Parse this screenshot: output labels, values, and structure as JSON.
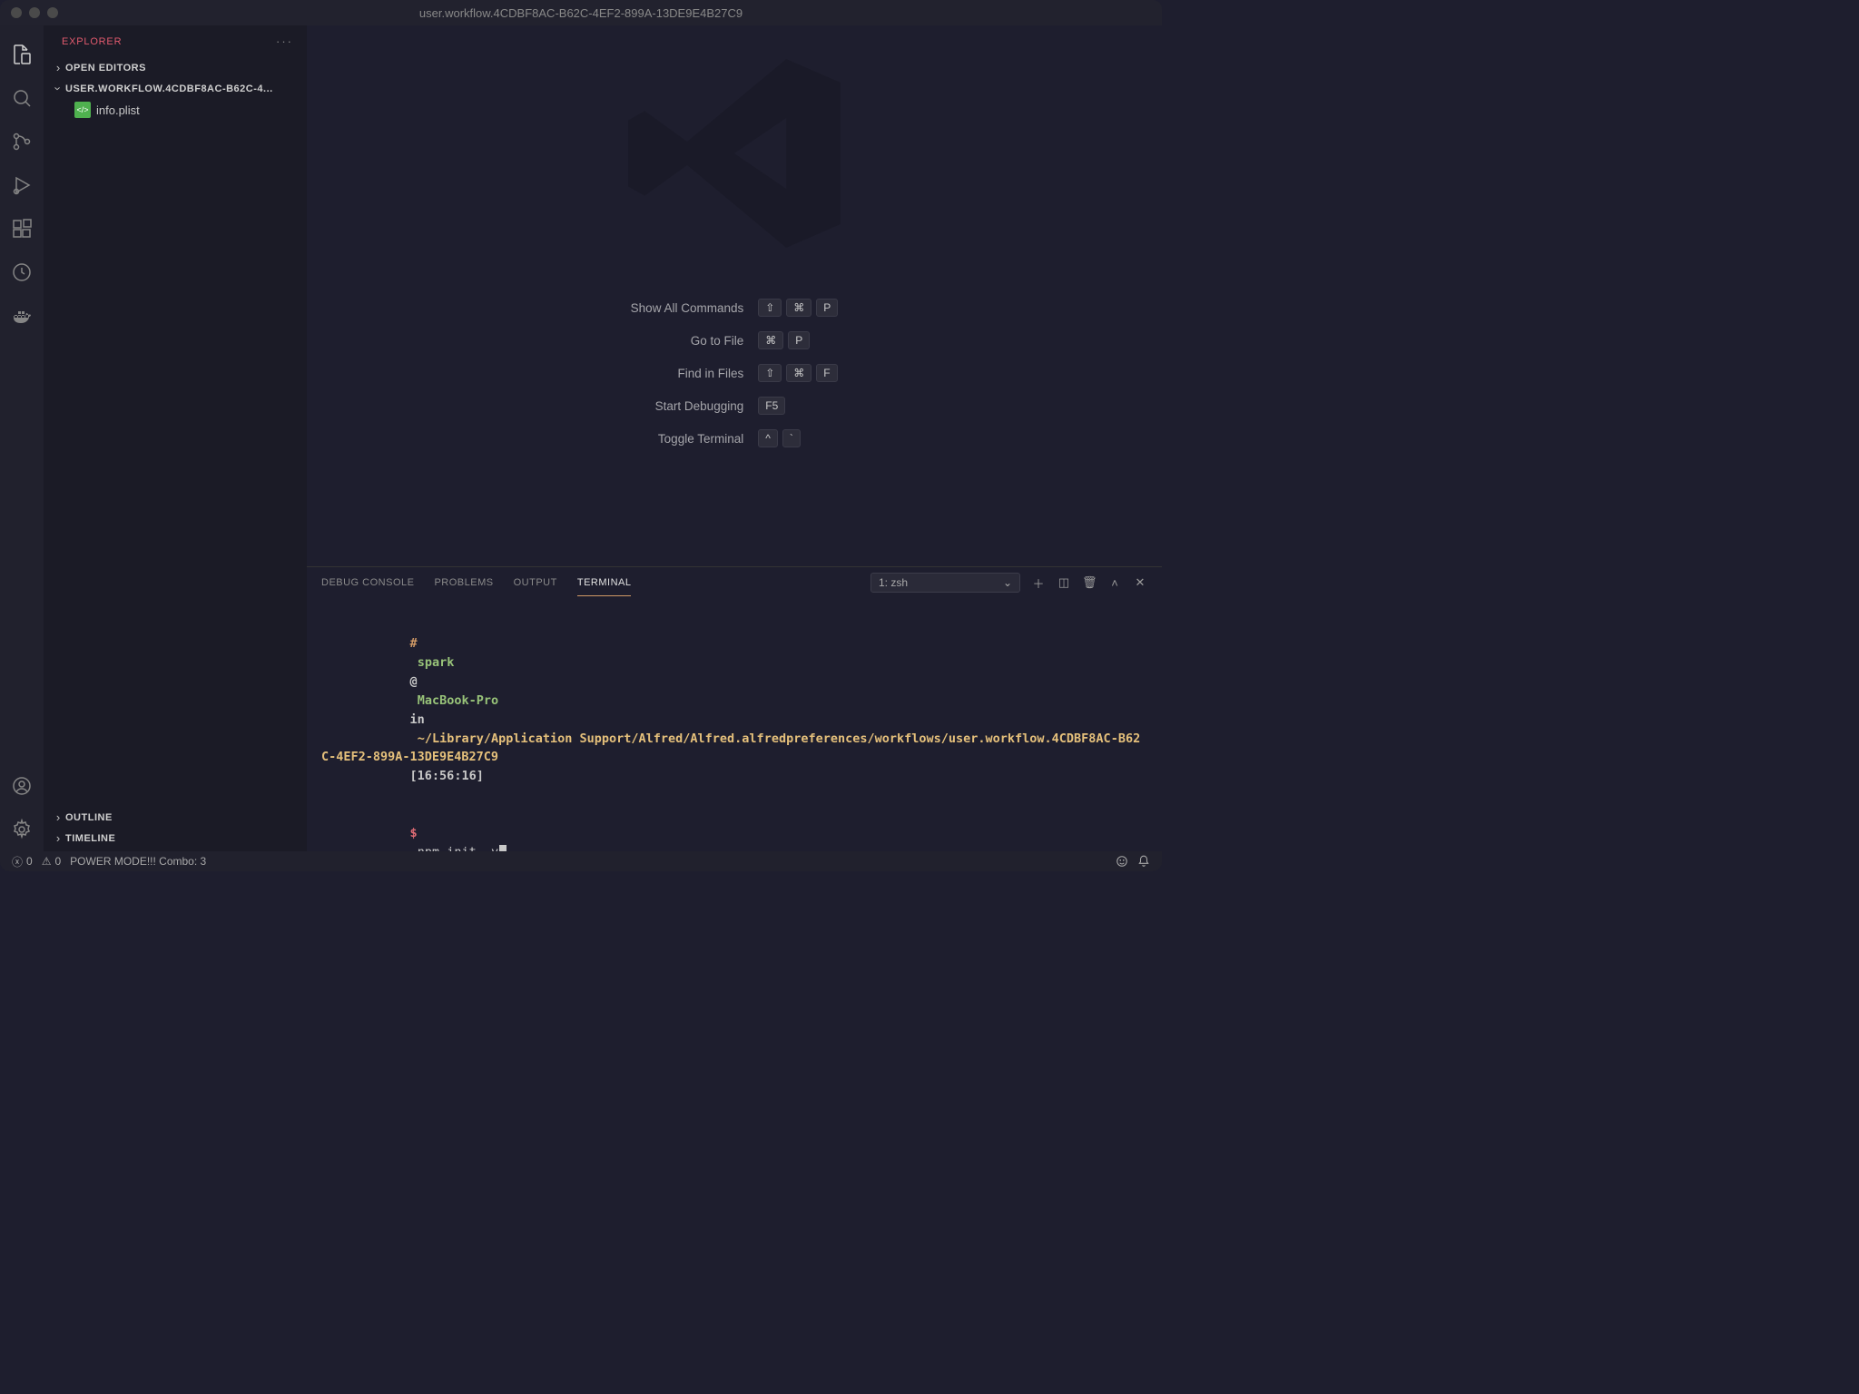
{
  "window": {
    "title": "user.workflow.4CDBF8AC-B62C-4EF2-899A-13DE9E4B27C9"
  },
  "sidebar": {
    "title": "EXPLORER",
    "sections": {
      "open_editors": "OPEN EDITORS",
      "workspace": "USER.WORKFLOW.4CDBF8AC-B62C-4...",
      "outline": "OUTLINE",
      "timeline": "TIMELINE"
    },
    "files": [
      {
        "name": "info.plist",
        "icon": "</>"
      }
    ]
  },
  "welcome": {
    "shortcuts": [
      {
        "label": "Show All Commands",
        "keys": [
          "⇧",
          "⌘",
          "P"
        ]
      },
      {
        "label": "Go to File",
        "keys": [
          "⌘",
          "P"
        ]
      },
      {
        "label": "Find in Files",
        "keys": [
          "⇧",
          "⌘",
          "F"
        ]
      },
      {
        "label": "Start Debugging",
        "keys": [
          "F5"
        ]
      },
      {
        "label": "Toggle Terminal",
        "keys": [
          "^",
          "`"
        ]
      }
    ]
  },
  "panel": {
    "tabs": [
      "DEBUG CONSOLE",
      "PROBLEMS",
      "OUTPUT",
      "TERMINAL"
    ],
    "active_tab": "TERMINAL",
    "terminal_select": "1: zsh"
  },
  "terminal": {
    "hash": "#",
    "user": "spark",
    "at": "@",
    "host": "MacBook-Pro",
    "in": "in",
    "path": "~/Library/Application Support/Alfred/Alfred.alfredpreferences/workflows/user.workflow.4CDBF8AC-B62C-4EF2-899A-13DE9E4B27C9",
    "time": "[16:56:16]",
    "prompt": "$",
    "command": "npm init -y"
  },
  "status": {
    "errors": "0",
    "warnings": "0",
    "power_mode": "POWER MODE!!! Combo: 3"
  }
}
